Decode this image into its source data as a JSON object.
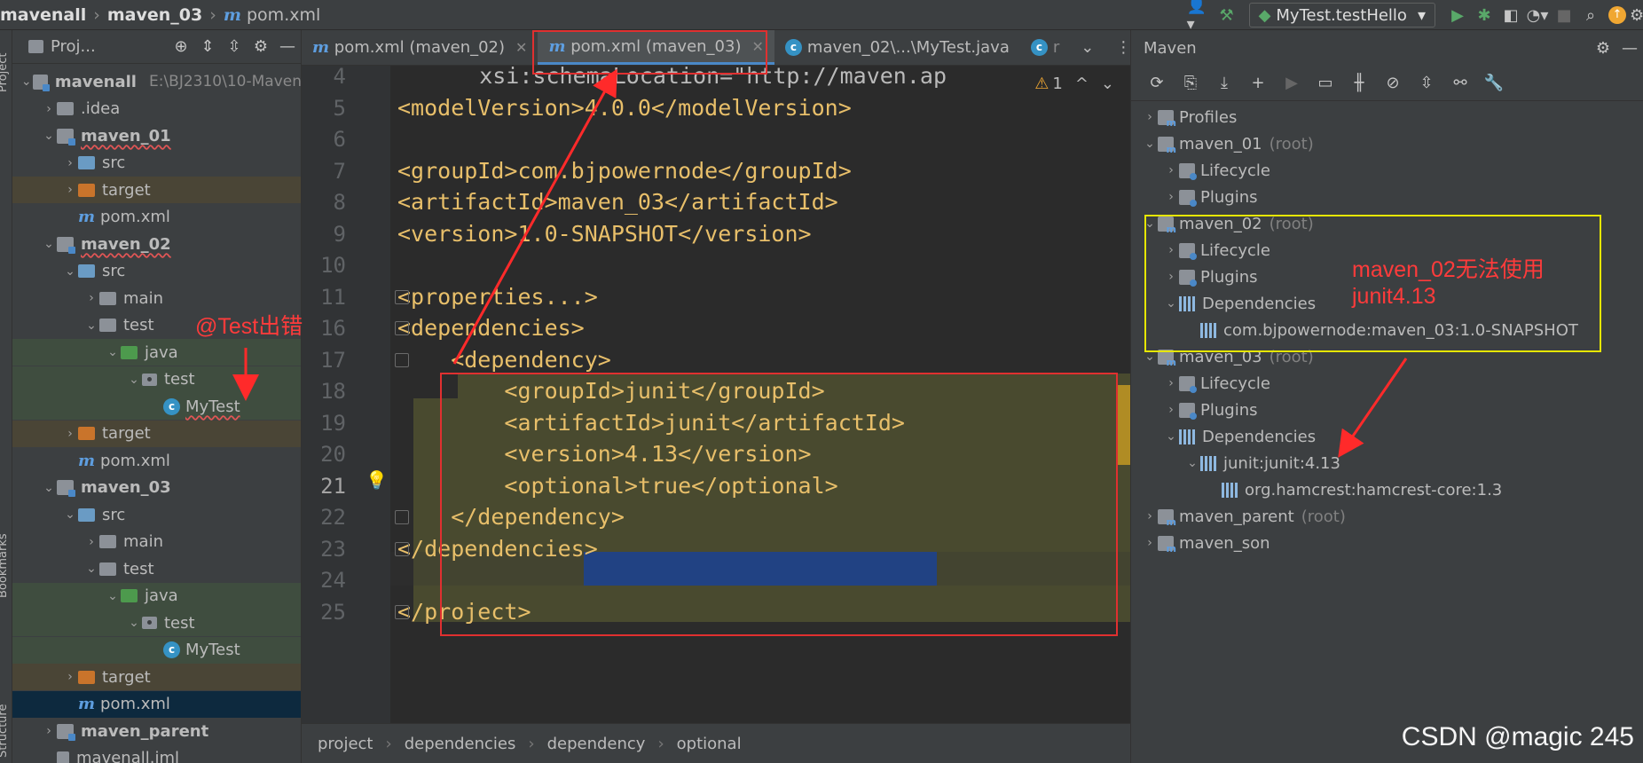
{
  "breadcrumb_top": {
    "project": "mavenall",
    "module": "maven_03",
    "file": "pom.xml"
  },
  "run_config": "MyTest.testHello",
  "project_panel": {
    "title": "Proj...",
    "rows": [
      {
        "label": "mavenall",
        "extra": "E:\\BJ2310\\10-Maven",
        "kind": "module"
      },
      {
        "label": ".idea",
        "kind": "folder"
      },
      {
        "label": "maven_01",
        "kind": "module"
      },
      {
        "label": "src",
        "kind": "folder"
      },
      {
        "label": "target",
        "kind": "folder"
      },
      {
        "label": "pom.xml",
        "kind": "pom"
      },
      {
        "label": "maven_02",
        "kind": "module"
      },
      {
        "label": "src",
        "kind": "folder"
      },
      {
        "label": "main",
        "kind": "folder"
      },
      {
        "label": "test",
        "kind": "folder"
      },
      {
        "label": "java",
        "kind": "folder"
      },
      {
        "label": "test",
        "kind": "package"
      },
      {
        "label": "MyTest",
        "kind": "class"
      },
      {
        "label": "target",
        "kind": "folder"
      },
      {
        "label": "pom.xml",
        "kind": "pom"
      },
      {
        "label": "maven_03",
        "kind": "module"
      },
      {
        "label": "src",
        "kind": "folder"
      },
      {
        "label": "main",
        "kind": "folder"
      },
      {
        "label": "test",
        "kind": "folder"
      },
      {
        "label": "java",
        "kind": "folder"
      },
      {
        "label": "test",
        "kind": "package"
      },
      {
        "label": "MyTest",
        "kind": "class"
      },
      {
        "label": "target",
        "kind": "folder"
      },
      {
        "label": "pom.xml",
        "kind": "pom"
      },
      {
        "label": "maven_parent",
        "kind": "module"
      },
      {
        "label": "mavenall.iml",
        "kind": "file"
      }
    ]
  },
  "tabs": [
    {
      "label": "pom.xml (maven_02)"
    },
    {
      "label": "pom.xml (maven_03)"
    },
    {
      "label": "maven_02\\...\\MyTest.java"
    },
    {
      "label": "r"
    }
  ],
  "editor": {
    "warnings": "1",
    "lines": [
      {
        "num": "4",
        "text": "    xsi:schemaLocation=\"http://maven.ap"
      },
      {
        "num": "5",
        "text": "<modelVersion>4.0.0</modelVersion>"
      },
      {
        "num": "6",
        "text": ""
      },
      {
        "num": "7",
        "text": "<groupId>com.bjpowernode</groupId>"
      },
      {
        "num": "8",
        "text": "<artifactId>maven_03</artifactId>"
      },
      {
        "num": "9",
        "text": "<version>1.0-SNAPSHOT</version>"
      },
      {
        "num": "10",
        "text": ""
      },
      {
        "num": "11",
        "text": "<properties...>"
      },
      {
        "num": "16",
        "text": "<dependencies>"
      },
      {
        "num": "17",
        "text": "    <dependency>"
      },
      {
        "num": "18",
        "text": "        <groupId>junit</groupId>"
      },
      {
        "num": "19",
        "text": "        <artifactId>junit</artifactId>"
      },
      {
        "num": "20",
        "text": "        <version>4.13</version>"
      },
      {
        "num": "21",
        "text": "        <optional>true</optional>"
      },
      {
        "num": "22",
        "text": "    </dependency>"
      },
      {
        "num": "23",
        "text": "</dependencies>"
      },
      {
        "num": "24",
        "text": ""
      },
      {
        "num": "25",
        "text": "</project>"
      }
    ]
  },
  "editor_breadcrumb": [
    "project",
    "dependencies",
    "dependency",
    "optional"
  ],
  "maven_panel": {
    "title": "Maven",
    "rows": [
      {
        "label": "Profiles"
      },
      {
        "label": "maven_01",
        "root": "(root)"
      },
      {
        "label": "Lifecycle"
      },
      {
        "label": "Plugins"
      },
      {
        "label": "maven_02",
        "root": "(root)"
      },
      {
        "label": "Lifecycle"
      },
      {
        "label": "Plugins"
      },
      {
        "label": "Dependencies"
      },
      {
        "label": "com.bjpowernode:maven_03:1.0-SNAPSHOT"
      },
      {
        "label": "maven_03",
        "root": "(root)"
      },
      {
        "label": "Lifecycle"
      },
      {
        "label": "Plugins"
      },
      {
        "label": "Dependencies"
      },
      {
        "label": "junit:junit:4.13"
      },
      {
        "label": "org.hamcrest:hamcrest-core:1.3"
      },
      {
        "label": "maven_parent",
        "root": "(root)"
      },
      {
        "label": "maven_son"
      }
    ]
  },
  "annotations": {
    "test_error": "@Test出错",
    "maven02_line1": "maven_02无法使用",
    "maven02_line2": "junit4.13"
  },
  "left_strip": {
    "project": "Project",
    "bookmarks": "Bookmarks",
    "structure": "Structure"
  },
  "watermark": "CSDN @magic 245",
  "colors": {
    "annotation_red": "#e03030",
    "annotation_yellow": "#e6e600",
    "selection": "#214283",
    "tag": "#e8bf6a"
  }
}
